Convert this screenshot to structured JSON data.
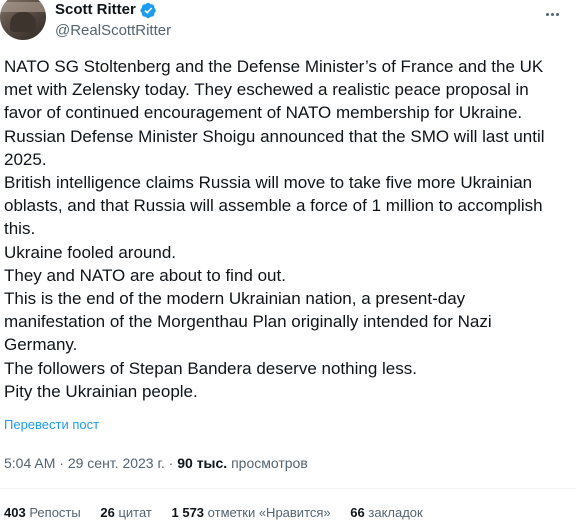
{
  "author": {
    "name": "Scott Ritter",
    "handle": "@RealScottRitter",
    "verified": true,
    "verified_color": "#1d9bf0"
  },
  "tweet": {
    "paragraphs": [
      "NATO SG Stoltenberg and the Defense Minister’s of France and the UK met with Zelensky today. They eschewed a realistic peace proposal in favor of continued encouragement of NATO membership for Ukraine.",
      "Russian Defense Minister Shoigu announced that the SMO will last until 2025.",
      "British intelligence claims Russia will move to take five more Ukrainian oblasts, and that Russia will assemble a force of 1 million to accomplish this.",
      "Ukraine fooled around.",
      "They and NATO are about to find out.",
      "This is the end of the modern Ukrainian nation, a present-day manifestation of the Morgenthau Plan originally intended for Nazi Germany.",
      "The followers of Stepan Bandera deserve nothing less.",
      "Pity the Ukrainian people."
    ],
    "translate_label": "Перевести пост"
  },
  "meta": {
    "time": "5:04 AM",
    "sep1": " · ",
    "date": "29 сент. 2023 г.",
    "sep2": " · ",
    "views_count": "90 тыс.",
    "views_label": "просмотров"
  },
  "stats": {
    "reposts_count": "403",
    "reposts_label": "Репосты",
    "quotes_count": "26",
    "quotes_label": "цитат",
    "likes_count": "1 573",
    "likes_label": "отметки «Нравится»",
    "bookmarks_count": "66",
    "bookmarks_label": "закладок"
  },
  "icons": {
    "more": "more-horizontal-icon",
    "verified": "verified-badge-icon"
  },
  "colors": {
    "text": "#0f1419",
    "secondary": "#536471",
    "link": "#1d9bf0",
    "divider": "#eff3f4"
  }
}
